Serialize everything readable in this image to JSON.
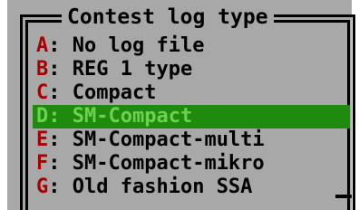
{
  "window": {
    "title": "Contest log type"
  },
  "menu": {
    "separator": ":",
    "selected_index": 3,
    "items": [
      {
        "key": "A",
        "label": "No log file"
      },
      {
        "key": "B",
        "label": "REG 1 type"
      },
      {
        "key": "C",
        "label": "Compact"
      },
      {
        "key": "D",
        "label": "SM-Compact"
      },
      {
        "key": "E",
        "label": "SM-Compact-multi"
      },
      {
        "key": "F",
        "label": "SM-Compact-mikro"
      },
      {
        "key": "G",
        "label": "Old fashion SSA"
      }
    ]
  },
  "colors": {
    "panel_bg": "#a8a8a8",
    "hotkey": "#a80000",
    "selected_bg": "#1e8a0e",
    "selected_fg": "#6fd24f",
    "text": "#000000"
  }
}
